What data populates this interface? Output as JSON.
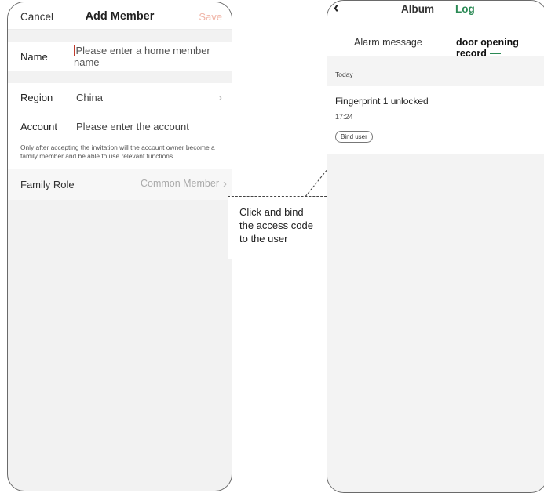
{
  "add_member": {
    "cancel_label": "Cancel",
    "title": "Add Member",
    "save_label": "Save",
    "name_label": "Name",
    "name_placeholder": "Please enter a home member name",
    "region_label": "Region",
    "region_value": "China",
    "account_label": "Account",
    "account_placeholder": "Please enter the account",
    "invitation_note": "Only after accepting the invitation will the account owner become a family member and be able to use relevant functions.",
    "family_role_label": "Family Role",
    "family_role_value": "Common Member"
  },
  "callout": {
    "line1": "Click and bind",
    "line2": "the access code",
    "line3": "to the user"
  },
  "log_screen": {
    "top_tabs": [
      "Album",
      "Log"
    ],
    "active_top_tab": "Log",
    "sub_tabs": [
      "Alarm message",
      "door opening record"
    ],
    "active_sub_tab": "door opening record",
    "date_header": "Today",
    "records": [
      {
        "event": "Fingerprint 1 unlocked",
        "time": "17:24",
        "action_label": "Bind user"
      }
    ]
  },
  "colors": {
    "accent_green": "#2b8a55",
    "save_disabled": "#f0b4a6",
    "cursor": "#c0392b"
  }
}
